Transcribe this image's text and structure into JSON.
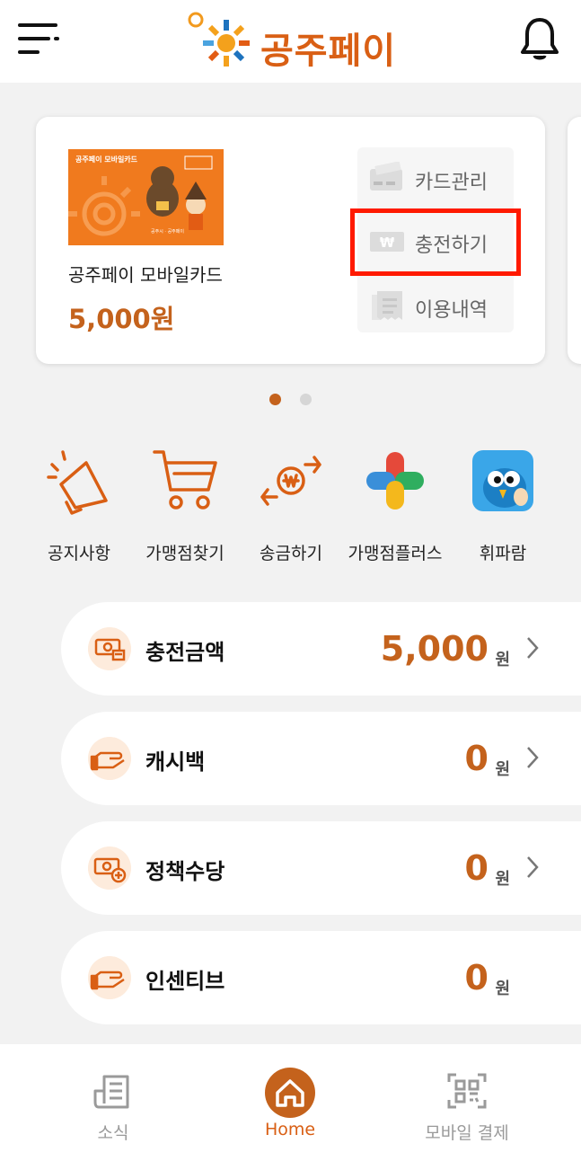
{
  "header": {
    "logo_text": "공주페이",
    "menu_icon": "menu-icon",
    "bell_icon": "bell-icon"
  },
  "card": {
    "image_title": "공주페이 모바일카드",
    "image_fineprint": "공주시 · 공주페이",
    "name": "공주페이 모바일카드",
    "balance": "5,000원",
    "actions": [
      {
        "label": "카드관리",
        "icon": "card-icon"
      },
      {
        "label": "충전하기",
        "icon": "won-icon"
      },
      {
        "label": "이용내역",
        "icon": "receipt-icon"
      }
    ],
    "highlighted_action": "충전하기"
  },
  "pager": {
    "count": 2,
    "active": 1
  },
  "quick_menu": [
    {
      "label": "공지사항",
      "icon": "megaphone-icon"
    },
    {
      "label": "가맹점찾기",
      "icon": "cart-icon"
    },
    {
      "label": "송금하기",
      "icon": "transfer-icon"
    },
    {
      "label": "가맹점플러스",
      "icon": "plus-icon"
    },
    {
      "label": "휘파람",
      "icon": "bird-app-icon"
    }
  ],
  "summary_rows": [
    {
      "label": "충전금액",
      "value": "5,000",
      "unit": "원",
      "icon": "money-icon",
      "chevron": true
    },
    {
      "label": "캐시백",
      "value": "0",
      "unit": "원",
      "icon": "hand-coin-icon",
      "chevron": true
    },
    {
      "label": "정책수당",
      "value": "0",
      "unit": "원",
      "icon": "money-plus-icon",
      "chevron": true
    },
    {
      "label": "인센티브",
      "value": "0",
      "unit": "원",
      "icon": "hand-coin-icon",
      "chevron": false
    }
  ],
  "tabbar": {
    "tabs": [
      {
        "label": "소식",
        "icon": "news-icon"
      },
      {
        "label": "Home",
        "icon": "home-icon",
        "active": true
      },
      {
        "label": "모바일 결제",
        "icon": "qr-icon"
      }
    ]
  },
  "colors": {
    "accent": "#d95f14",
    "value_text": "#c4621c",
    "highlight_box": "#ff1a00",
    "background": "#f2f2f2"
  }
}
